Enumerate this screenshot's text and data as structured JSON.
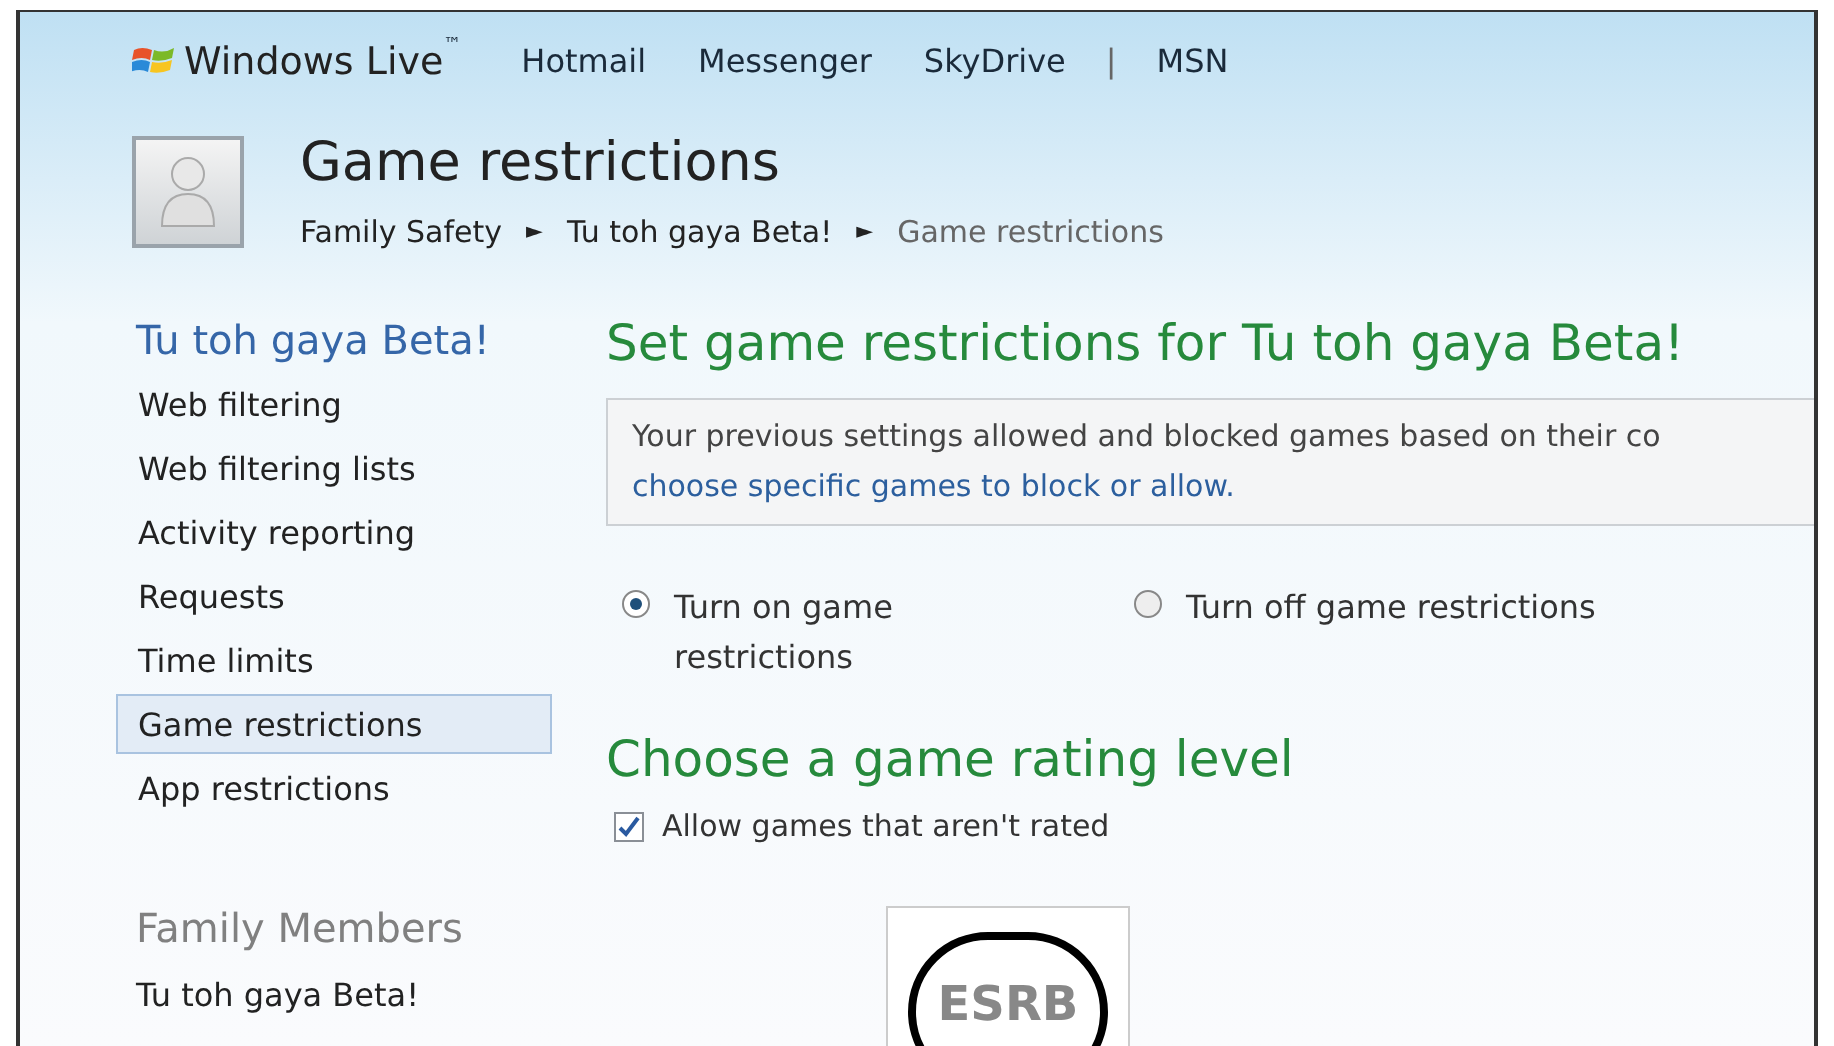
{
  "header": {
    "brand": "Windows Live",
    "trademark": "™",
    "nav": [
      {
        "label": "Hotmail"
      },
      {
        "label": "Messenger"
      },
      {
        "label": "SkyDrive"
      },
      {
        "label": "|",
        "kind": "separator"
      },
      {
        "label": "MSN"
      }
    ]
  },
  "page": {
    "title": "Game restrictions",
    "breadcrumb": [
      {
        "label": "Family Safety",
        "current": false
      },
      {
        "label": "Tu toh gaya Beta!",
        "current": false
      },
      {
        "label": "Game restrictions",
        "current": true
      }
    ],
    "breadcrumb_separator": "►"
  },
  "sidebar": {
    "heading": "Tu toh gaya Beta!",
    "items": [
      {
        "label": "Web filtering",
        "selected": false
      },
      {
        "label": "Web filtering lists",
        "selected": false
      },
      {
        "label": "Activity reporting",
        "selected": false
      },
      {
        "label": "Requests",
        "selected": false
      },
      {
        "label": "Time limits",
        "selected": false
      },
      {
        "label": "Game restrictions",
        "selected": true
      },
      {
        "label": "App restrictions",
        "selected": false
      }
    ],
    "members_heading": "Family Members",
    "members": [
      {
        "label": "Tu toh gaya Beta!"
      }
    ]
  },
  "main": {
    "heading": "Set game restrictions for Tu toh gaya Beta!",
    "notice": {
      "text": "Your previous settings allowed and blocked games based on their co",
      "link": "choose specific games to block or allow."
    },
    "options": [
      {
        "label": "Turn on game restrictions",
        "selected": true
      },
      {
        "label": "Turn off game restrictions",
        "selected": false
      }
    ],
    "rating_heading": "Choose a game rating level",
    "allow_unrated": {
      "label": "Allow games that aren't rated",
      "checked": true
    },
    "rating_logo": "ESRB"
  }
}
